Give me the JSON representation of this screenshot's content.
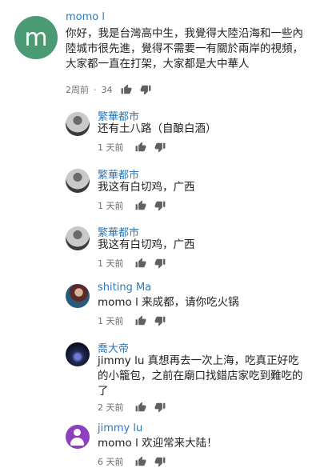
{
  "comments": [
    {
      "author": "momo l",
      "avatar_letter": "m",
      "text": "你好，我是台灣高中生，我覺得大陸沿海和一些內陸城市很先進，覺得不需要一有關於兩岸的視頻，大家都一直在打架，大家都是大中華人",
      "time": "2周前",
      "sep": "·",
      "likes": "34"
    },
    {
      "author": "繁華都市",
      "text": "还有土八路（自酿白酒）",
      "time": "1 天前"
    },
    {
      "author": "繁華都市",
      "text": "我这有白切鸡，广西",
      "time": "1 天前"
    },
    {
      "author": "繁華都市",
      "text": "我这有白切鸡，广西",
      "time": "1 天前"
    },
    {
      "author": "shiting Ma",
      "text": "momo l 来成都，请你吃火锅",
      "time": "1 天前"
    },
    {
      "author": "喬大帝",
      "text": "jimmy lu 真想再去一次上海，吃真正好吃的小籠包，之前在廟口找錯店家吃到難吃的了",
      "time": "2 天前"
    },
    {
      "author": "jimmy lu",
      "text": "momo l 欢迎常来大陆！",
      "time": "6 天前"
    }
  ],
  "icons": {
    "like": "thumbs-up-icon",
    "dislike": "thumbs-down-icon",
    "user": "user-icon"
  },
  "colors": {
    "author": "#2f77b8",
    "avatar_main": "#4a9a74",
    "avatar_user": "#8e3fbf"
  }
}
